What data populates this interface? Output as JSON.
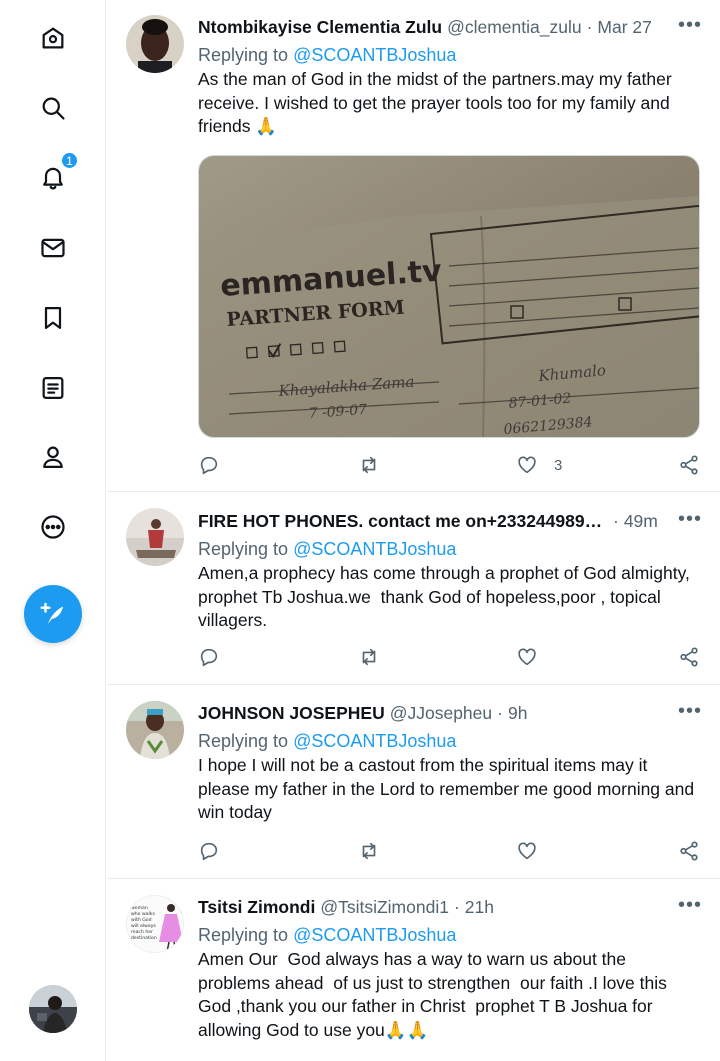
{
  "sidebar": {
    "items": [
      {
        "name": "home-icon"
      },
      {
        "name": "search-icon"
      },
      {
        "name": "notifications-icon",
        "badge": "1"
      },
      {
        "name": "messages-icon"
      },
      {
        "name": "bookmarks-icon"
      },
      {
        "name": "lists-icon"
      },
      {
        "name": "profile-icon"
      },
      {
        "name": "more-icon"
      }
    ],
    "compose_icon": "compose-tweet-icon",
    "accent": "#1d9bf0"
  },
  "tweets": [
    {
      "name": "Ntombikayise Clementia Zulu",
      "handle": "@clementia_zulu",
      "time": "Mar 27",
      "reply_prefix": "Replying to",
      "mention": "@SCOANTBJoshua",
      "text": "As the man of God in the midst of the partners.may my father receive. I wished to get the prayer tools too for my family and friends",
      "emoji": "🙏",
      "likes": "3",
      "media": {
        "logo": "emmanuel.tv",
        "title": "PARTNER FORM",
        "handwriting_name": "Khayalakha Zama",
        "handwriting_date": "87-01-02",
        "handwriting_surname": "Khumalo",
        "handwriting_number": "0662129384"
      }
    },
    {
      "name": "FIRE HOT PHONES. contact me on+2332449891...",
      "handle": "",
      "time": "49m",
      "reply_prefix": "Replying to",
      "mention": "@SCOANTBJoshua",
      "text": "Amen,a prophecy has come through a prophet of God almighty, prophet Tb Joshua.we  thank God of hopeless,poor , topical villagers.",
      "likes": ""
    },
    {
      "name": "JOHNSON JOSEPHEU",
      "handle": "@JJosepheu",
      "time": "9h",
      "reply_prefix": "Replying to",
      "mention": "@SCOANTBJoshua",
      "text": "I hope I will not be a castout from the spiritual items may it please my father in the Lord to remember me good morning and win today",
      "likes": ""
    },
    {
      "name": "Tsitsi Zimondi",
      "handle": "@TsitsiZimondi1",
      "time": "21h",
      "reply_prefix": "Replying to",
      "mention": "@SCOANTBJoshua",
      "text": "Amen Our  God always has a way to warn us about the problems ahead  of us just to strengthen  our faith .I love this God ,thank you our father in Christ  prophet T B Joshua for allowing God to use you",
      "emoji": "🙏🙏",
      "avatar_text": "woman who walks with God will always reach her destination"
    }
  ]
}
